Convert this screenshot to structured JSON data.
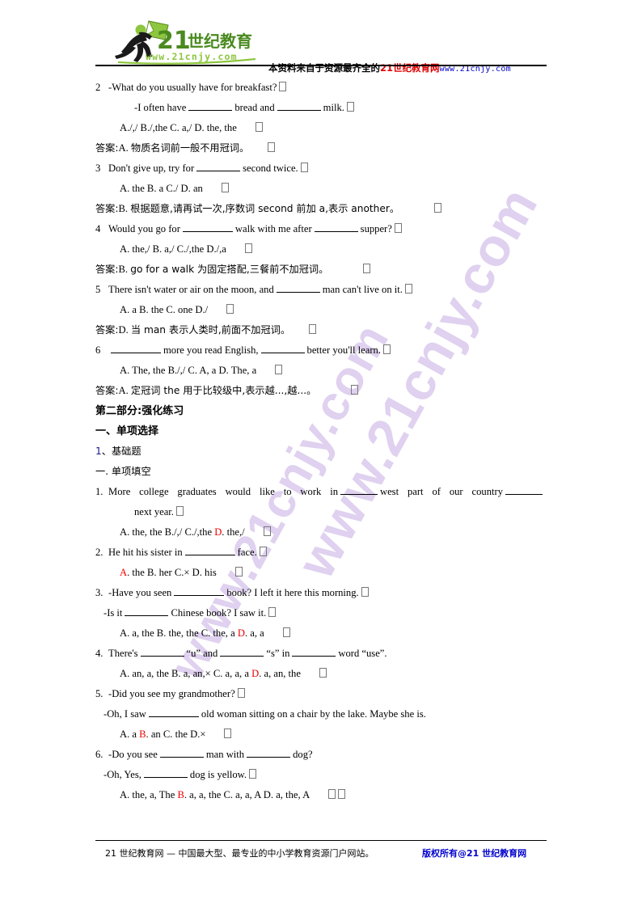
{
  "header": {
    "logo": {
      "brand_number": "21",
      "brand_cn": "世纪教育",
      "brand_url": "www.21cnjy.com",
      "runner_color": "#7ab648",
      "text_color": "#4a8a1f"
    },
    "banner": {
      "black_part": "本资料来自于资源最齐全的",
      "red_part": "21世纪教育网",
      "blue_part": "www.21cnjy.com"
    }
  },
  "watermark": {
    "text": "www.21cnjy.com",
    "color": "#ccb6e6"
  },
  "colors": {
    "answer_red": "#ee0000",
    "heading_navy": "#1a1a8c",
    "link_blue": "#0000cc",
    "banner_red": "#e00000"
  },
  "body": {
    "lines": [
      {
        "num": "2",
        "text": "-What do you usually have for breakfast?"
      },
      {
        "text": "-I often have"
      },
      {
        "mid": "bread and"
      },
      {
        "tail": "milk."
      },
      {
        "options": "A./,/    B./,the    C. a,/    D. the, the"
      },
      {
        "answer_label": "答案:",
        "answer_letter": "A.",
        "answer_text": "物质名词前一般不用冠词。"
      },
      {
        "num": "3",
        "text": "Don't give up, try for"
      },
      {
        "tail": "second twice."
      },
      {
        "options": "A. the    B. a    C./    D. an"
      },
      {
        "answer_label": "答案:",
        "answer_letter": "B.",
        "answer_text": "根据题意,请再试一次,序数词 second 前加 a,表示 another。"
      },
      {
        "num": "4",
        "text": "Would you go for"
      },
      {
        "mid": "walk with me after"
      },
      {
        "tail": "supper?"
      },
      {
        "options": "A. the,/    B. a,/    C./,the    D./,a"
      },
      {
        "answer_label": "答案:",
        "answer_letter": "B.",
        "answer_text": "go for a walk 为固定搭配,三餐前不加冠词。"
      },
      {
        "num": "5",
        "text": "There isn't water or air on the moon, and"
      },
      {
        "tail": "man can't live on it."
      },
      {
        "options": "A. a    B. the    C. one    D./"
      },
      {
        "answer_label": "答案:",
        "answer_letter": "D.",
        "answer_text": "当 man 表示人类时,前面不加冠词。"
      },
      {
        "num": "6",
        "mid": "more you read English,",
        "tail": "better you'll learn."
      },
      {
        "options": "A. The, the    B./,/    C. A, a    D. The, a"
      },
      {
        "answer_label": "答案:",
        "answer_letter": "A.",
        "answer_text": "定冠词 the 用于比较级中,表示越...,越...。"
      }
    ],
    "q2": {
      "number": "2",
      "prompt": "-What do you usually have for breakfast?",
      "line2_a": "-I often have",
      "line2_b": "bread and",
      "line2_c": "milk.",
      "options": "A./,/    B./,the    C. a,/    D. the, the",
      "answer_label": "答案:",
      "answer_letter": "A.",
      "answer_text": "物质名词前一般不用冠词。"
    },
    "q3": {
      "number": "3",
      "prompt_a": "Don't give up, try for",
      "prompt_b": "second twice.",
      "options": "A. the    B. a    C./    D. an",
      "answer_label": "答案:",
      "answer_letter": "B.",
      "answer_text": "根据题意,请再试一次,序数词 second 前加 a,表示 another。"
    },
    "q4": {
      "number": "4",
      "prompt_a": "Would you go for",
      "prompt_b": "walk with me after",
      "prompt_c": "supper?",
      "options": "A. the,/    B. a,/    C./,the    D./,a",
      "answer_label": "答案:",
      "answer_letter": "B.",
      "answer_text": "go for a walk 为固定搭配,三餐前不加冠词。"
    },
    "q5": {
      "number": "5",
      "prompt_a": "There isn't water or air on the moon, and",
      "prompt_b": "man can't live on it.",
      "options": "A. a    B. the    C. one    D./",
      "answer_label": "答案:",
      "answer_letter": "D.",
      "answer_text": "当 man 表示人类时,前面不加冠词。"
    },
    "q6": {
      "number": "6",
      "prompt_a": "more you read English,",
      "prompt_b": "better you'll learn.",
      "options": "A. The, the    B./,/    C. A, a    D. The, a",
      "answer_label": "答案:",
      "answer_letter": "A.",
      "answer_text": "定冠词 the 用于比较级中,表示越...,越...。"
    },
    "headings": {
      "part2": "第二部分:强化练习",
      "section1": "一、单项选择",
      "sub1_num": "1",
      "sub1_text": "、基础题",
      "sub2": "一. 单项填空"
    },
    "p2q1": {
      "number": "1.",
      "seg1": "More   college   graduates   would   like   to   work   in",
      "seg2": "west   part   of   our   country",
      "line2": "next year.",
      "options_pre": "A. the, the   B./,/   C./,the   ",
      "options_red": "D",
      "options_post": ". the,/"
    },
    "p2q2": {
      "number": "2.",
      "seg1": "He hit his sister in",
      "seg2": "face.",
      "opt_red": "A",
      "opt_rest": ". the    B. her    C.×    D. his"
    },
    "p2q3": {
      "number": "3.",
      "seg1": "-Have you seen",
      "seg2": "book? I left it here this morning.",
      "line2a": "-Is it",
      "line2b": "Chinese book? I saw it.",
      "opt_pre": "A. a, the    B. the, the    C. the, a    ",
      "opt_red": "D",
      "opt_post": ". a, a"
    },
    "p2q4": {
      "number": "4.",
      "seg1": "There's",
      "seg2": "“u” and",
      "seg3": "“s” in",
      "seg4": "word “use”.",
      "opt_pre": "A. an, a, the    B. a, an,×    C. a, a, a    ",
      "opt_red": "D",
      "opt_post": ". a, an, the"
    },
    "p2q5": {
      "number": "5.",
      "seg1": "-Did you see my grandmother?",
      "line2a": "-Oh, I saw",
      "line2b": "old woman sitting on a chair by the lake. Maybe she is.",
      "opt_pre": "A. a    ",
      "opt_red": "B",
      "opt_post": ". an    C. the    D.×"
    },
    "p2q6": {
      "number": "6.",
      "seg1": "-Do you see",
      "seg2": "man with",
      "seg3": "dog?",
      "line2a": "-Oh, Yes,",
      "line2b": "dog is yellow.",
      "opt_pre": "A. the, a, The    ",
      "opt_red": "B",
      "opt_post": ". a, a, the    C. a, a, A    D. a, the, A"
    }
  },
  "footer": {
    "left": "21 世纪教育网 — 中国最大型、最专业的中小学教育资源门户网站。",
    "right": "版权所有@21 世纪教育网"
  }
}
